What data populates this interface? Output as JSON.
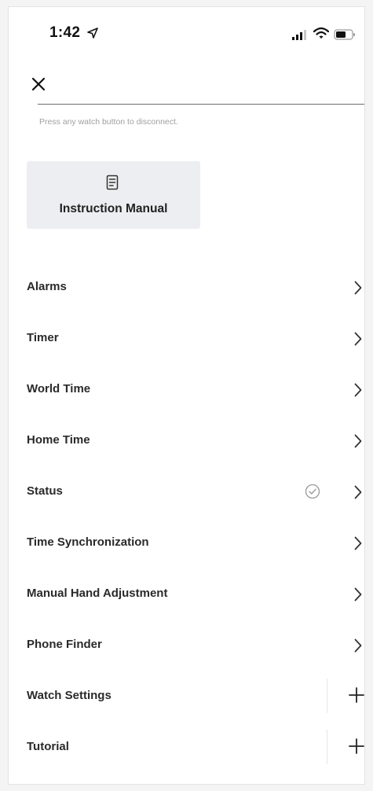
{
  "status_bar": {
    "time": "1:42",
    "icons": [
      "location-arrow-icon",
      "signal-icon",
      "wifi-icon",
      "battery-icon"
    ]
  },
  "close_icon": "close-icon",
  "hint": "Press any watch button to disconnect.",
  "manual": {
    "label": "Instruction Manual",
    "icon": "document-icon"
  },
  "menu": [
    {
      "label": "Alarms",
      "trailing": "chevron"
    },
    {
      "label": "Timer",
      "trailing": "chevron"
    },
    {
      "label": "World Time",
      "trailing": "chevron"
    },
    {
      "label": "Home Time",
      "trailing": "chevron"
    },
    {
      "label": "Status",
      "trailing": "chevron",
      "status_icon": "check-circle-icon"
    },
    {
      "label": "Time Synchronization",
      "trailing": "chevron"
    },
    {
      "label": "Manual Hand Adjustment",
      "trailing": "chevron"
    },
    {
      "label": "Phone Finder",
      "trailing": "chevron"
    },
    {
      "label": "Watch Settings",
      "trailing": "plus"
    },
    {
      "label": "Tutorial",
      "trailing": "plus"
    }
  ],
  "colors": {
    "background": "#ffffff",
    "card": "#eceef1",
    "text": "#2a2a2a",
    "hint": "#a0a0a0"
  }
}
